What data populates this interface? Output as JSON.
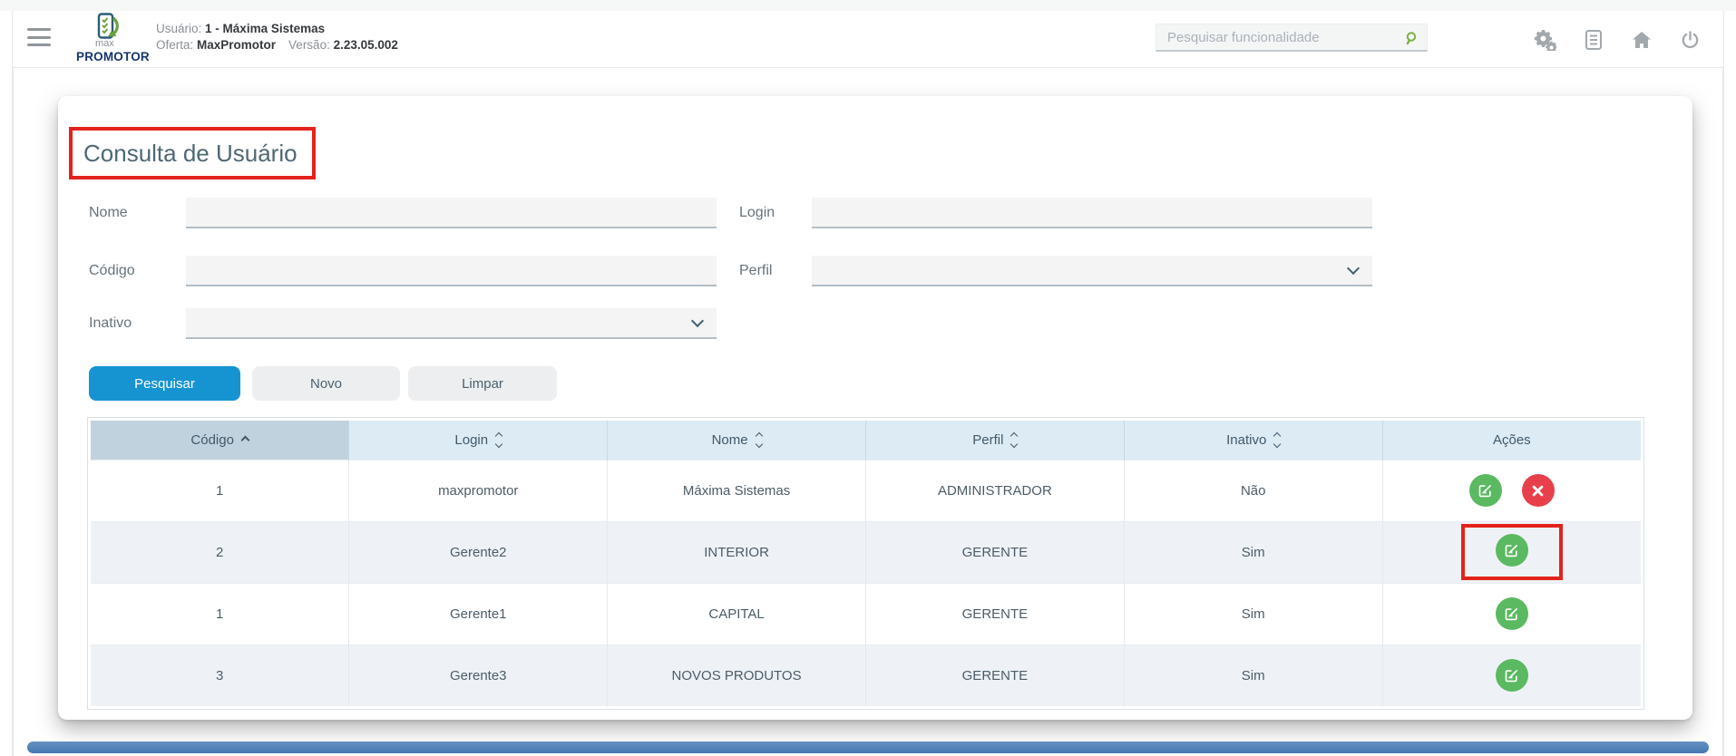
{
  "header": {
    "logo_top": "max",
    "logo_bottom": "PROMOTOR",
    "user_label": "Usuário:",
    "user_value": "1 - Máxima Sistemas",
    "offer_label": "Oferta:",
    "offer_value": "MaxPromotor",
    "version_label": "Versão:",
    "version_value": "2.23.05.002",
    "search_placeholder": "Pesquisar funcionalidade"
  },
  "main": {
    "title": "Consulta de Usuário",
    "form": {
      "nome_label": "Nome",
      "login_label": "Login",
      "codigo_label": "Código",
      "perfil_label": "Perfil",
      "inativo_label": "Inativo",
      "nome_value": "",
      "login_value": "",
      "codigo_value": "",
      "perfil_value": "",
      "inativo_value": ""
    },
    "buttons": {
      "pesquisar": "Pesquisar",
      "novo": "Novo",
      "limpar": "Limpar"
    }
  },
  "table": {
    "columns": [
      {
        "label": "Código",
        "sort": "asc"
      },
      {
        "label": "Login",
        "sort": "unsorted"
      },
      {
        "label": "Nome",
        "sort": "unsorted"
      },
      {
        "label": "Perfil",
        "sort": "unsorted"
      },
      {
        "label": "Inativo",
        "sort": "unsorted"
      },
      {
        "label": "Ações",
        "sort": "none"
      }
    ],
    "rows": [
      {
        "codigo": "1",
        "login": "maxpromotor",
        "nome": "Máxima Sistemas",
        "perfil": "ADMINISTRADOR",
        "inativo": "Não",
        "actions": [
          "edit",
          "delete"
        ]
      },
      {
        "codigo": "2",
        "login": "Gerente2",
        "nome": "INTERIOR",
        "perfil": "GERENTE",
        "inativo": "Sim",
        "actions": [
          "edit"
        ],
        "annotated": true
      },
      {
        "codigo": "1",
        "login": "Gerente1",
        "nome": "CAPITAL",
        "perfil": "GERENTE",
        "inativo": "Sim",
        "actions": [
          "edit"
        ]
      },
      {
        "codigo": "3",
        "login": "Gerente3",
        "nome": "NOVOS PRODUTOS",
        "perfil": "GERENTE",
        "inativo": "Sim",
        "actions": [
          "edit"
        ]
      }
    ]
  },
  "colors": {
    "primary_blue": "#1694d2",
    "edit_green": "#5bb961",
    "delete_red": "#e7404a",
    "annotation_red": "#e3231b",
    "table_header_bg": "#dcebf4",
    "table_header_sorted_bg": "#c0d2dd",
    "field_bg": "#f4f4f5",
    "scrollbar_blue": "#4b80b8",
    "logo_navy": "#16356b",
    "logo_green": "#6aa23e"
  }
}
